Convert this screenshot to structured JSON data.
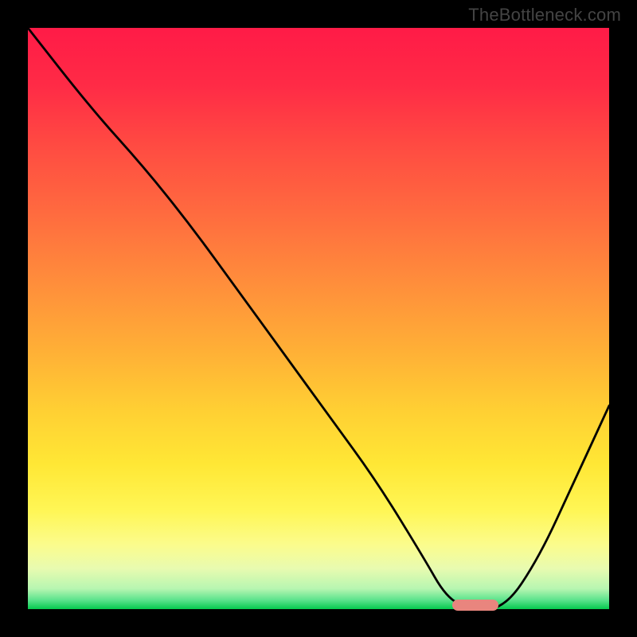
{
  "watermark": "TheBottleneck.com",
  "chart_data": {
    "type": "line",
    "title": "",
    "xlabel": "",
    "ylabel": "",
    "xlim": [
      0,
      100
    ],
    "ylim": [
      0,
      100
    ],
    "series": [
      {
        "name": "bottleneck-curve",
        "x": [
          0,
          11,
          20,
          28,
          36,
          44,
          52,
          60,
          68,
          72,
          76,
          82,
          88,
          94,
          100
        ],
        "values": [
          100,
          86,
          76,
          66,
          55,
          44,
          33,
          22,
          9,
          2,
          0,
          0,
          9,
          22,
          35
        ]
      }
    ],
    "optimal_marker": {
      "x_start": 73,
      "x_end": 81,
      "y": 0
    },
    "background": "rainbow-vertical-gradient",
    "grid": false,
    "legend": false
  }
}
